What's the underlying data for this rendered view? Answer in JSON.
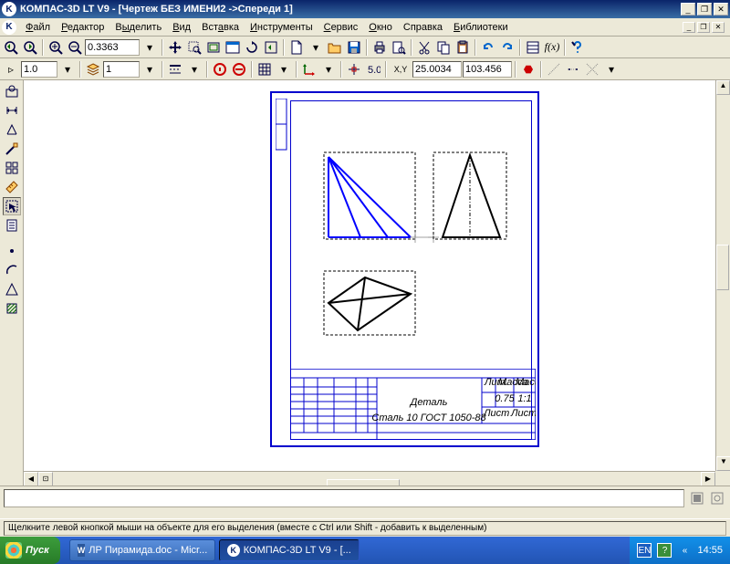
{
  "window": {
    "title": "КОМПАС-3D LT V9 - [Чертеж БЕЗ ИМЕНИ2 ->Спереди 1]",
    "app_icon": "K"
  },
  "menu": {
    "items": [
      {
        "label": "Файл",
        "u": 0
      },
      {
        "label": "Редактор",
        "u": 0
      },
      {
        "label": "Выделить",
        "u": 0
      },
      {
        "label": "Вид",
        "u": 0
      },
      {
        "label": "Вставка",
        "u": 0
      },
      {
        "label": "Инструменты",
        "u": 0
      },
      {
        "label": "Сервис",
        "u": 0
      },
      {
        "label": "Окно",
        "u": 0
      },
      {
        "label": "Справка",
        "u": 0
      },
      {
        "label": "Библиотеки",
        "u": 0
      }
    ]
  },
  "toolbar1": {
    "zoom_value": "0.3363"
  },
  "toolbar2": {
    "scale": "1.0",
    "layer": "1",
    "coord_x": "25.0034",
    "coord_y": "103.456"
  },
  "drawing": {
    "part_label": "Деталь",
    "material": "Сталь 10 ГОСТ 1050-88",
    "tb_val1": "0.75",
    "tb_val2": "1:1"
  },
  "statusbar": {
    "text": "Щелкните левой кнопкой мыши на объекте для его выделения (вместе с Ctrl или Shift - добавить к выделенным)"
  },
  "taskbar": {
    "start": "Пуск",
    "task1": "ЛР Пирамида.doc - Micr...",
    "task2": "КОМПАС-3D LT V9 - [...",
    "lang": "EN",
    "time": "14:55",
    "chevron": "«"
  }
}
